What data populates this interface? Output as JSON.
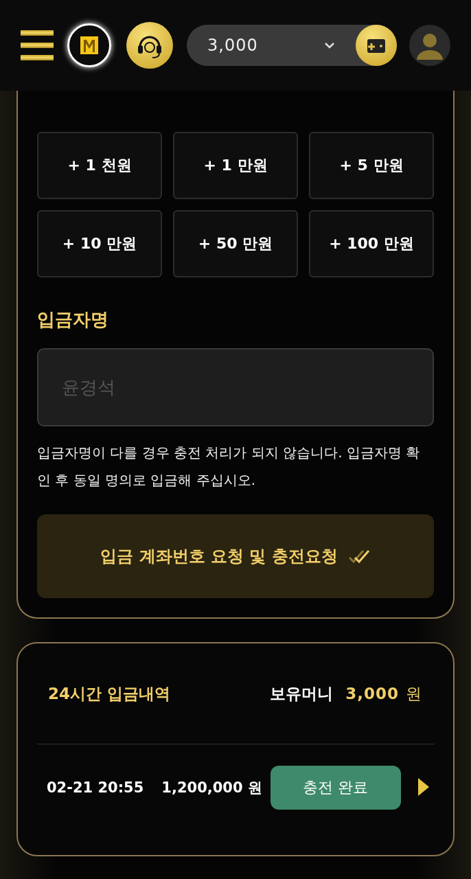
{
  "header": {
    "balance": "3,000"
  },
  "deposit": {
    "amount_buttons": [
      "+ 1 천원",
      "+ 1 만원",
      "+ 5 만원",
      "+ 10 만원",
      "+ 50 만원",
      "+ 100 만원"
    ],
    "depositor_label": "입금자명",
    "depositor_field": {
      "placeholder": "윤경석"
    },
    "notice": "입금자명이 다를 경우 충전 처리가 되지 않습니다. 입금자명 확인 후 동일 명의로 입금해 주십시오.",
    "submit_button": "입금 계좌번호 요청 및 충전요청"
  },
  "history": {
    "title": "24시간 입금내역",
    "balance_label": "보유머니",
    "balance_value": "3,000",
    "balance_unit": "원",
    "rows": [
      {
        "datetime": "02-21 20:55",
        "amount": "1,200,000 원",
        "status": "충전 완료"
      }
    ]
  }
}
